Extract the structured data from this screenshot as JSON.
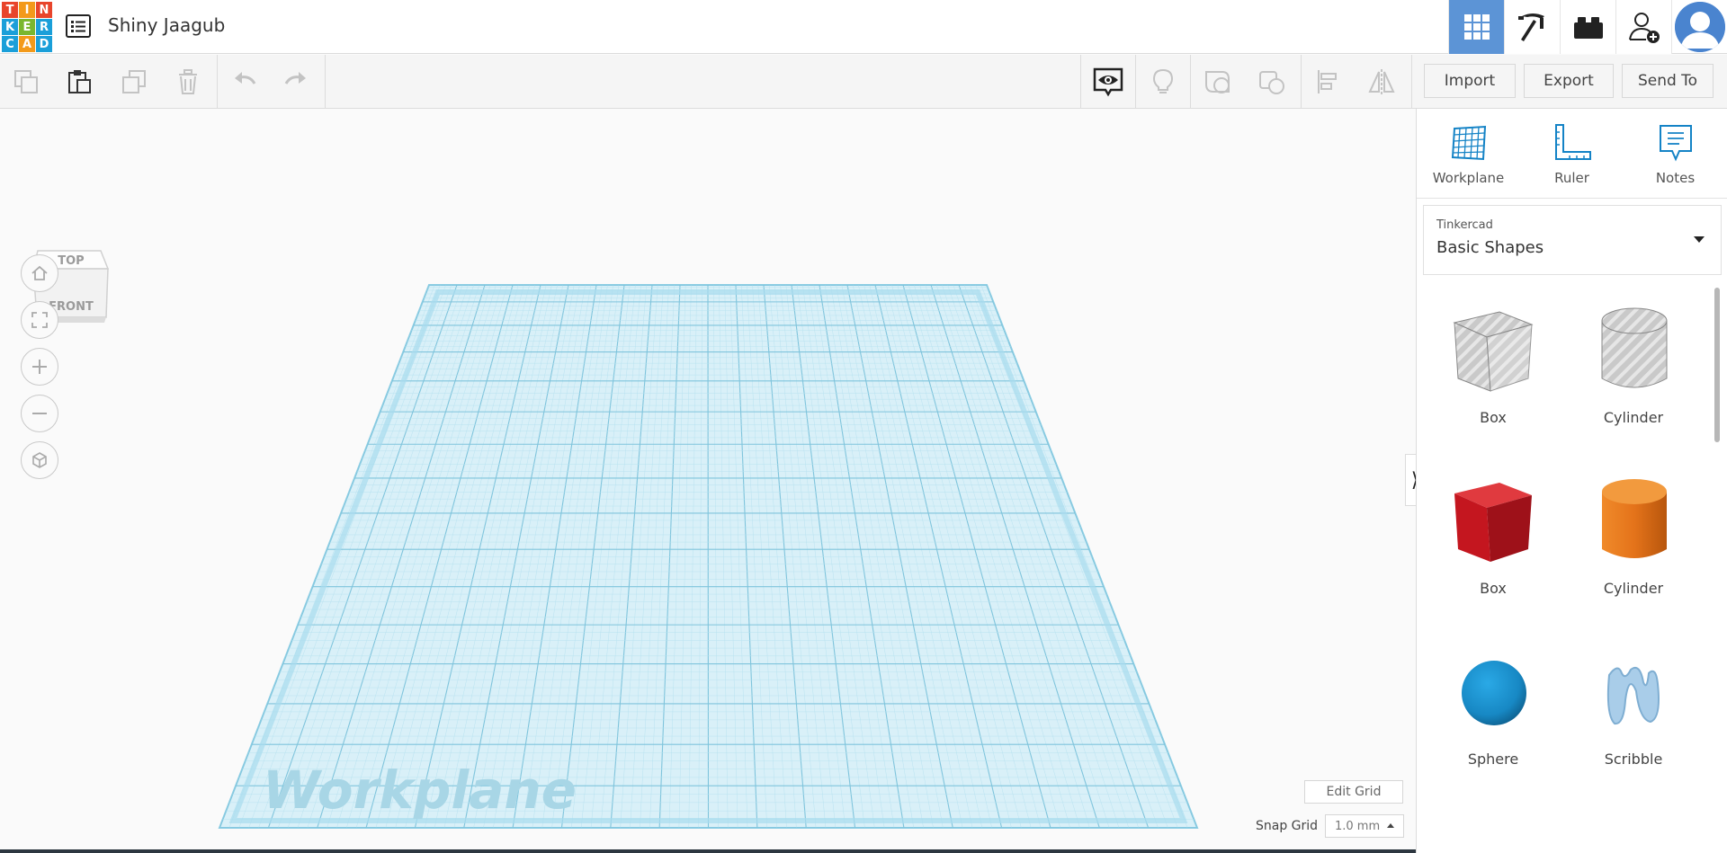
{
  "app": {
    "logo_letters": [
      "T",
      "I",
      "N",
      "K",
      "E",
      "R",
      "C",
      "A",
      "D"
    ],
    "logo_colors": [
      "#e8452c",
      "#f39a1b",
      "#e8452c",
      "#1a9fd9",
      "#7ab72f",
      "#1a9fd9",
      "#1a9fd9",
      "#f39a1b",
      "#1a9fd9"
    ],
    "design_title": "Shiny Jaagub"
  },
  "topbar": {
    "buttons": [
      {
        "name": "3d-design-view",
        "icon": "grid-icon",
        "active": true
      },
      {
        "name": "codeblocks",
        "icon": "pickaxe-icon",
        "active": false
      },
      {
        "name": "bricks",
        "icon": "brick-icon",
        "active": false
      },
      {
        "name": "invite-user",
        "icon": "add-user-icon",
        "active": false
      }
    ],
    "accent": "#5c94d6"
  },
  "toolbar": {
    "left_icons": [
      "copy-icon",
      "paste-icon",
      "duplicate-icon",
      "delete-icon",
      "undo-icon",
      "redo-icon"
    ],
    "right_icons": [
      "notes-eye-icon",
      "light-bulb-icon",
      "group-icon",
      "ungroup-icon",
      "align-icon",
      "mirror-icon"
    ],
    "import_label": "Import",
    "export_label": "Export",
    "send_to_label": "Send To"
  },
  "viewport": {
    "viewcube_top": "TOP",
    "viewcube_front": "FRONT",
    "nav_icons": [
      "home-icon",
      "fit-icon",
      "zoom-in-icon",
      "zoom-out-icon",
      "perspective-icon"
    ],
    "workplane_text": "Workplane",
    "edit_grid_label": "Edit Grid",
    "snap_grid_label": "Snap Grid",
    "snap_grid_value": "1.0 mm",
    "grid_color": "#9ed8ea"
  },
  "panel": {
    "tools": [
      {
        "label": "Workplane",
        "icon": "workplane-icon"
      },
      {
        "label": "Ruler",
        "icon": "ruler-icon"
      },
      {
        "label": "Notes",
        "icon": "notes-icon"
      }
    ],
    "library_source": "Tinkercad",
    "library_name": "Basic Shapes",
    "shapes": [
      {
        "label": "Box",
        "kind": "hole-box"
      },
      {
        "label": "Cylinder",
        "kind": "hole-cylinder"
      },
      {
        "label": "Box",
        "kind": "box",
        "color": "#d4202b"
      },
      {
        "label": "Cylinder",
        "kind": "cylinder",
        "color": "#e7781a"
      },
      {
        "label": "Sphere",
        "kind": "sphere",
        "color": "#1993cc"
      },
      {
        "label": "Scribble",
        "kind": "scribble",
        "color": "#a8cdea"
      }
    ]
  }
}
